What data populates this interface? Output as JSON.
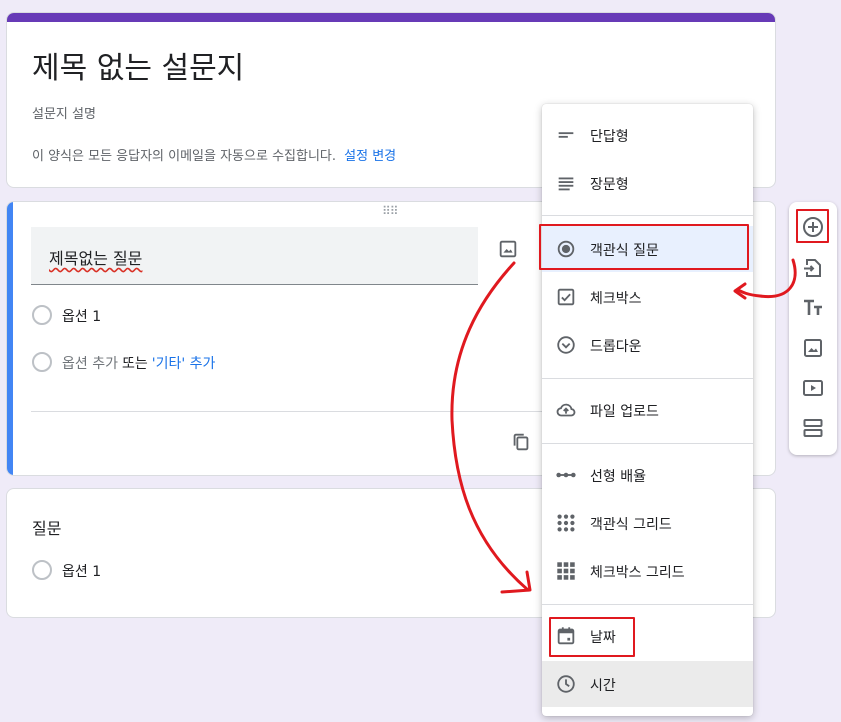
{
  "header": {
    "title": "제목 없는 설문지",
    "description_placeholder": "설문지 설명",
    "email_notice": "이 양식은 모든 응답자의 이메일을 자동으로 수집합니다.",
    "settings_link": "설정 변경",
    "accent_color": "#673ab7"
  },
  "question1": {
    "title": "제목없는 질문",
    "option1": "옵션 1",
    "add_option": "옵션 추가",
    "or_text": "또는",
    "add_other": "'기타' 추가",
    "accent_color": "#4285f4"
  },
  "question2": {
    "title": "질문",
    "option1": "옵션 1"
  },
  "dropdown": {
    "items": [
      {
        "label": "단답형",
        "icon": "short-answer-icon"
      },
      {
        "label": "장문형",
        "icon": "paragraph-icon"
      },
      {
        "label": "객관식 질문",
        "icon": "radio-button-icon"
      },
      {
        "label": "체크박스",
        "icon": "checkbox-icon"
      },
      {
        "label": "드롭다운",
        "icon": "dropdown-icon"
      },
      {
        "label": "파일 업로드",
        "icon": "cloud-upload-icon"
      },
      {
        "label": "선형 배율",
        "icon": "linear-scale-icon"
      },
      {
        "label": "객관식 그리드",
        "icon": "multiple-choice-grid-icon"
      },
      {
        "label": "체크박스 그리드",
        "icon": "checkbox-grid-icon"
      },
      {
        "label": "날짜",
        "icon": "calendar-icon"
      },
      {
        "label": "시간",
        "icon": "clock-icon"
      }
    ],
    "selected": "객관식 질문"
  },
  "toolbar": {
    "buttons": [
      "add-question-icon",
      "import-questions-icon",
      "add-title-icon",
      "add-image-icon",
      "add-video-icon",
      "add-section-icon"
    ]
  },
  "annotation_color": "#e0191f"
}
